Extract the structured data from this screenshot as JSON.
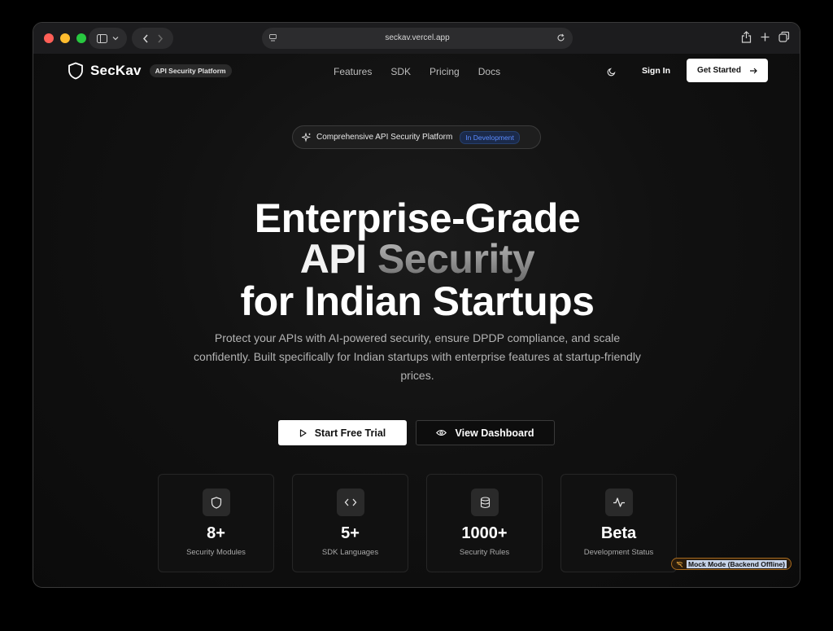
{
  "browser": {
    "url": "seckav.vercel.app"
  },
  "nav": {
    "brand": "SecKav",
    "badge": "API Security Platform",
    "links": [
      "Features",
      "SDK",
      "Pricing",
      "Docs"
    ],
    "sign_in": "Sign In",
    "get_started": "Get Started"
  },
  "hero": {
    "chip_text": "Comprehensive API Security Platform",
    "chip_badge": "In Development",
    "line1": "Enterprise-Grade",
    "line2a": "API ",
    "line2b": "Security",
    "line3": "for Indian Startups",
    "subtitle": "Protect your APIs with AI-powered security, ensure DPDP compliance, and scale confidently. Built specifically for Indian startups with enterprise features at startup-friendly prices.",
    "cta_primary": "Start Free Trial",
    "cta_secondary": "View Dashboard"
  },
  "stats": [
    {
      "value": "8+",
      "label": "Security Modules",
      "icon": "shield-icon"
    },
    {
      "value": "5+",
      "label": "SDK Languages",
      "icon": "code-icon"
    },
    {
      "value": "1000+",
      "label": "Security Rules",
      "icon": "database-icon"
    },
    {
      "value": "Beta",
      "label": "Development Status",
      "icon": "activity-icon"
    }
  ],
  "mock_badge": "Mock Mode (Backend Offline)",
  "colors": {
    "accent_blue": "#5b8cff",
    "warning_border": "#a86a1e"
  }
}
